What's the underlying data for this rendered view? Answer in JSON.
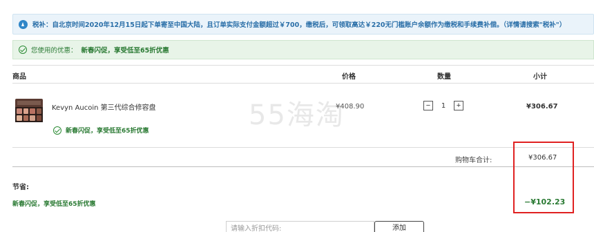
{
  "notice": {
    "text": "税补：自北京时间2020年12月15日起下单寄至中国大陆，且订单实际支付金额超过￥700，缴税后，可领取高达￥220无门槛账户余额作为缴税和手续费补偿。（详情请搜索\"税补\"）"
  },
  "coupon": {
    "label": "您使用的优惠：",
    "value": "新春闪促，享受低至65折优惠"
  },
  "table": {
    "headers": {
      "product": "商品",
      "price": "价格",
      "quantity": "数量",
      "subtotal": "小计"
    },
    "item": {
      "name": "Kevyn Aucoin 第三代综合修容盘",
      "promo": "新春闪促，享受低至65折优惠",
      "price": "¥408.90",
      "quantity": "1",
      "minus": "−",
      "plus": "+",
      "subtotal": "¥306.67"
    }
  },
  "cart_total": {
    "label": "购物车合计:",
    "value": "¥306.67"
  },
  "savings": {
    "label": "节省:",
    "name": "新春闪促，享受低至65折优惠",
    "value": "−¥102.23"
  },
  "watermark": "55海淘",
  "coupon_entry": {
    "placeholder": "请输入折扣代码:",
    "button": "添加"
  },
  "colors": {
    "info_blue": "#2a6fa8",
    "success_green": "#2a7a33",
    "highlight_red": "#e02020"
  },
  "swatches": [
    "#c9897a",
    "#d9a28c",
    "#b87262",
    "#8c5a48",
    "#e0b49a",
    "#a86a56",
    "#cfa08a",
    "#7d4a3a"
  ]
}
